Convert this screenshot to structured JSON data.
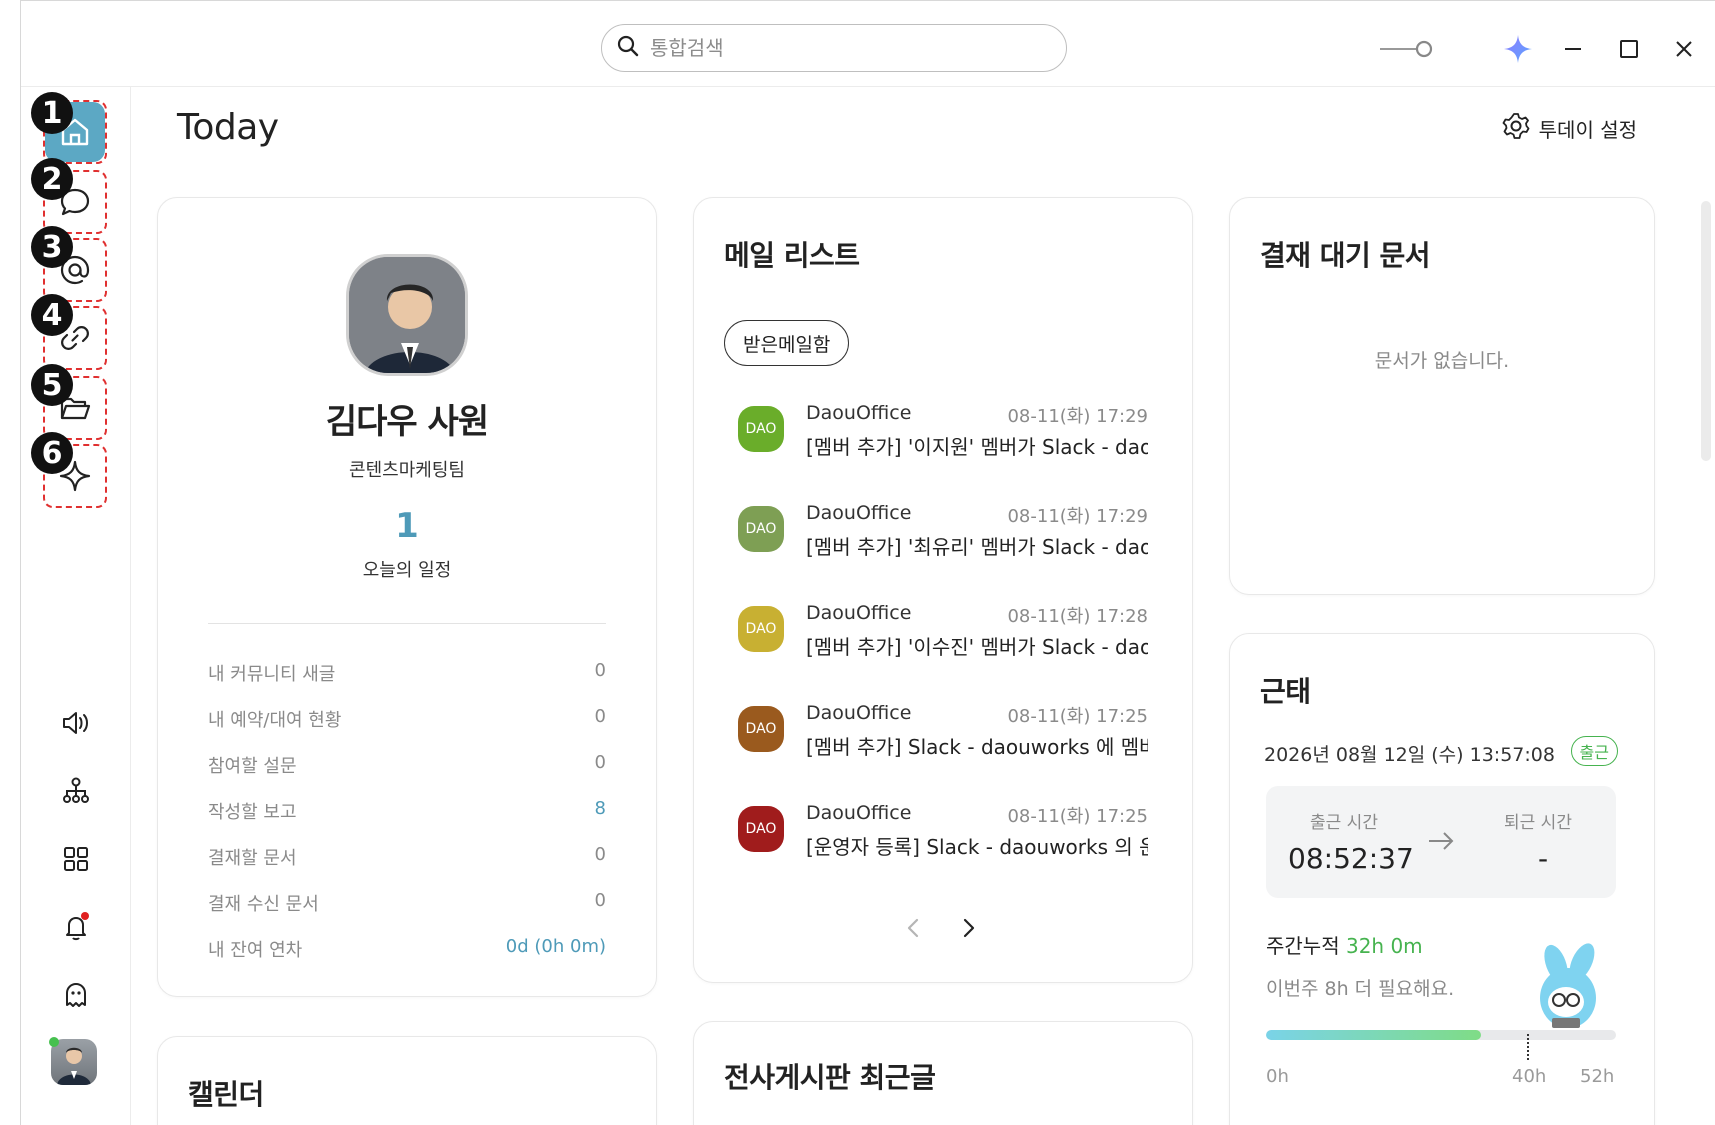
{
  "search": {
    "placeholder": "통합검색"
  },
  "page": {
    "title": "Today",
    "settings_label": "투데이 설정"
  },
  "sidebar": {
    "nav": [
      {
        "num": "1",
        "icon": "home-icon",
        "active": true
      },
      {
        "num": "2",
        "icon": "chat-icon"
      },
      {
        "num": "3",
        "icon": "at-sign-icon"
      },
      {
        "num": "4",
        "icon": "link-icon"
      },
      {
        "num": "5",
        "icon": "folder-icon"
      },
      {
        "num": "6",
        "icon": "sparkle-icon"
      }
    ],
    "bottom_icons": [
      "speaker-icon",
      "org-chart-icon",
      "apps-grid-icon",
      "bell-icon",
      "ghost-icon"
    ]
  },
  "profile": {
    "name": "김다우 사원",
    "team": "콘텐츠마케팅팀",
    "schedule_count": "1",
    "schedule_label": "오늘의 일정",
    "stats": [
      {
        "label": "내 커뮤니티 새글",
        "value": "0"
      },
      {
        "label": "내 예약/대여 현황",
        "value": "0"
      },
      {
        "label": "참여할 설문",
        "value": "0"
      },
      {
        "label": "작성할 보고",
        "value": "8",
        "highlight": true
      },
      {
        "label": "결재할 문서",
        "value": "0"
      },
      {
        "label": "결재 수신 문서",
        "value": "0"
      },
      {
        "label": "내 잔여 연차",
        "value": "0d (0h 0m)",
        "highlight": true
      }
    ]
  },
  "mail": {
    "title": "메일 리스트",
    "inbox_label": "받은메일함",
    "items": [
      {
        "logo": "DAO",
        "color": "#6aad2a",
        "sender": "DaouOffice",
        "date": "08-11(화) 17:29",
        "subject": "[멤버 추가] '이지원' 멤버가 Slack - daouworks"
      },
      {
        "logo": "DAO",
        "color": "#7e9f54",
        "sender": "DaouOffice",
        "date": "08-11(화) 17:29",
        "subject": "[멤버 추가] '최유리' 멤버가 Slack - daouworks"
      },
      {
        "logo": "DAO",
        "color": "#c8b032",
        "sender": "DaouOffice",
        "date": "08-11(화) 17:28",
        "subject": "[멤버 추가] '이수진' 멤버가 Slack - daouworks"
      },
      {
        "logo": "DAO",
        "color": "#9a5a1e",
        "sender": "DaouOffice",
        "date": "08-11(화) 17:25",
        "subject": "[멤버 추가] Slack - daouworks 에 멤버가"
      },
      {
        "logo": "DAO",
        "color": "#a01c1c",
        "sender": "DaouOffice",
        "date": "08-11(화) 17:25",
        "subject": "[운영자 등록] Slack - daouworks 의 운영자"
      }
    ]
  },
  "approval": {
    "title": "결재 대기 문서",
    "empty": "문서가 없습니다."
  },
  "attendance": {
    "title": "근태",
    "datetime": "2026년 08월 12일 (수) 13:57:08",
    "status": "출근",
    "in_label": "출근 시간",
    "in_value": "08:52:37",
    "out_label": "퇴근 시간",
    "out_value": "-",
    "weekly_label": "주간누적",
    "weekly_value": "32h 0m",
    "need_text": "이번주 8h 더 필요해요.",
    "progress_fraction": 0.615,
    "ticks": [
      "0h",
      "40h",
      "52h"
    ]
  },
  "calendar": {
    "title": "캘린더"
  },
  "board": {
    "title": "전사게시판 최근글"
  }
}
